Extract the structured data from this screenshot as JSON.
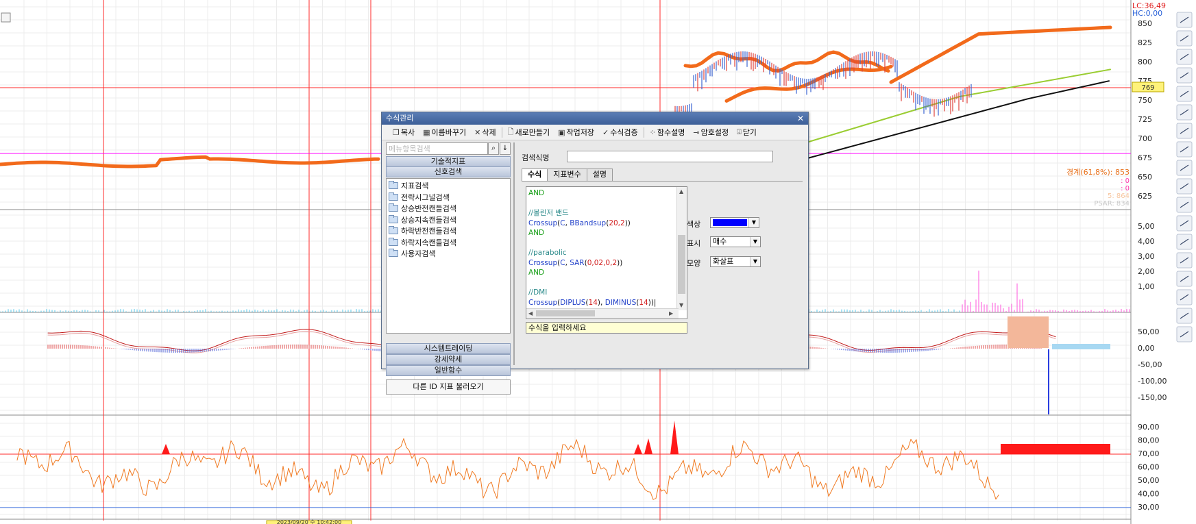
{
  "chart": {
    "price_axis": [
      "850",
      "825",
      "800",
      "775",
      "750",
      "725",
      "700",
      "675",
      "650",
      "625"
    ],
    "volume_axis": [
      "5,00",
      "4,00",
      "3,00",
      "2,00",
      "1,00"
    ],
    "macd_axis": [
      "50,00",
      "0,00",
      "-50,00",
      "-100,00",
      "-150,00"
    ],
    "rsi_axis": [
      "90,00",
      "80,00",
      "70,00",
      "60,00",
      "50,00",
      "40,00",
      "30,00"
    ],
    "lc_label": "LC:36,49",
    "hc_label": "HC:0,00",
    "price_tag": "769",
    "fib_label": "경계(61,8%): 853",
    "val_a": ": 0",
    "val_b": ": 0",
    "val_c": "5: 864",
    "psar_label": "PSAR: 834",
    "date_tag": "2023/09/20 수 10:42:00",
    "colors": {
      "orange": "#f26a1b",
      "green": "#9acd32",
      "black": "#111111",
      "red_line": "#ff2a2a",
      "magenta": "#ff00ff",
      "blue_axis": "#2a62d8"
    }
  },
  "dialog": {
    "title": "수식관리",
    "toolbar": [
      "복사",
      "이름바꾸기",
      "삭제",
      "새로만들기",
      "작업저장",
      "수식검증",
      "함수설명",
      "암호설정",
      "닫기"
    ],
    "search_placeholder": "메뉴항목검색",
    "categories_top": [
      "기술적지표",
      "신호검색"
    ],
    "tree": [
      "지표검색",
      "전략시그널검색",
      "상승반전캔들검색",
      "상승지속캔들검색",
      "하락반전캔들검색",
      "하락지속캔들검색",
      "사용자검색"
    ],
    "categories_bottom": [
      "시스템트레이딩",
      "강세약세",
      "일반함수"
    ],
    "import_button": "다른 ID 지표 불러오기",
    "name_label": "검색식명",
    "tabs": [
      "수식",
      "지표변수",
      "설명"
    ],
    "code": {
      "and": "AND",
      "comment_bb": "//볼린저 밴드",
      "comment_parabolic": "//parabolic",
      "comment_dmi": "//DMI",
      "crossup": "Crossup",
      "c": "C",
      "bband": "BBandsup",
      "bband_args": "20,2",
      "sar": "SAR",
      "sar_args": "0,02,0,2",
      "diplus": "DIPLUS",
      "diminus": "DIMINUS",
      "dmi_arg": "14"
    },
    "hint": "수식을 입력하세요",
    "props": {
      "color_label": "색상",
      "color_value": "#0000ff",
      "display_label": "표시",
      "display_value": "매수",
      "shape_label": "모양",
      "shape_value": "화살표"
    }
  }
}
